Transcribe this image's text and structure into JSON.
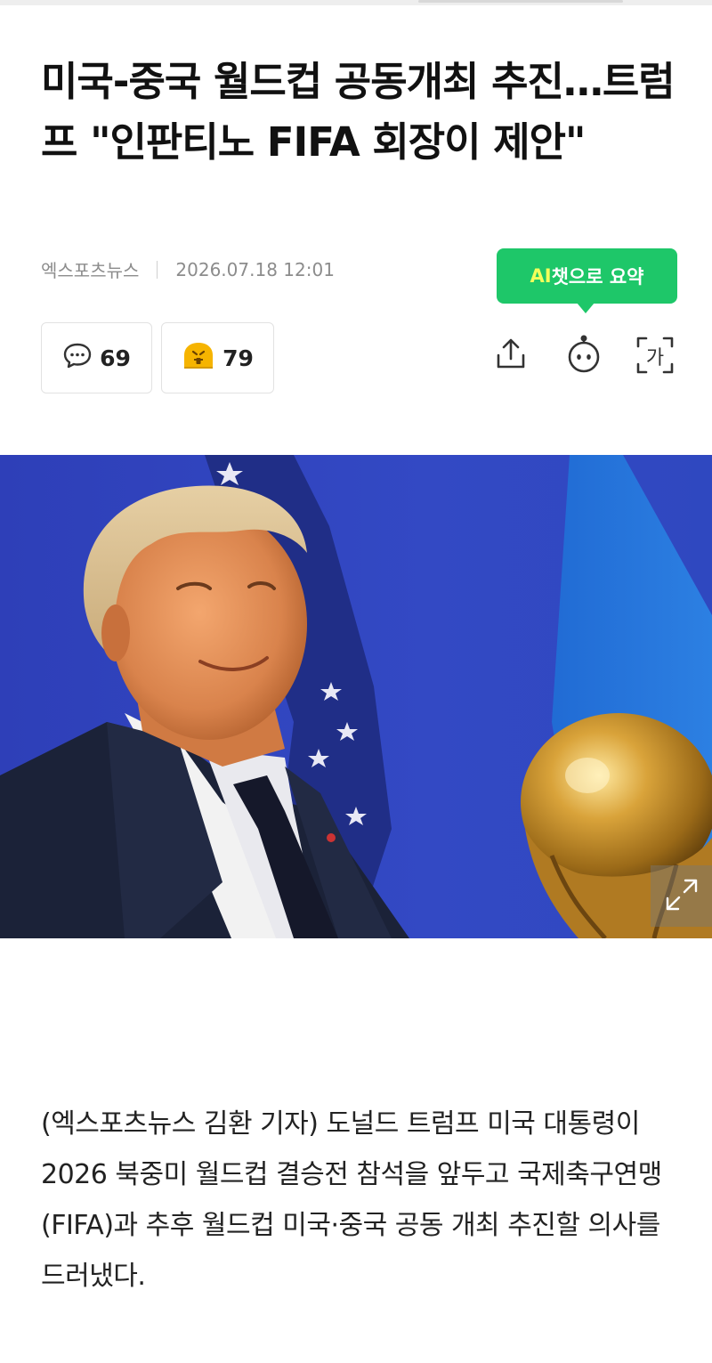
{
  "article": {
    "headline": "미국-중국 월드컵 공동개최 추진…트럼프 \"인판티노 FIFA 회장이 제안\"",
    "source": "엑스포츠뉴스",
    "timestamp": "2026.07.18 12:01",
    "body": "(엑스포츠뉴스 김환 기자) 도널드 트럼프 미국 대통령이 2026 북중미 월드컵 결승전 참석을 앞두고 국제축구연맹(FIFA)과 추후 월드컵 미국·중국 공동 개최 추진할 의사를 드러냈다."
  },
  "ai_summary": {
    "prefix": "AI",
    "label": "챗으로 요약"
  },
  "reactions": {
    "comments_count": "69",
    "emoji_count": "79"
  },
  "toolbar": {
    "share_icon": "share-icon",
    "bot_icon": "chatbot-icon",
    "font_size_icon": "font-size-icon",
    "font_size_label": "가"
  },
  "colors": {
    "accent_green": "#1ec769",
    "accent_yellow": "#f4ff5a",
    "emoji_yellow": "#f6b400"
  }
}
